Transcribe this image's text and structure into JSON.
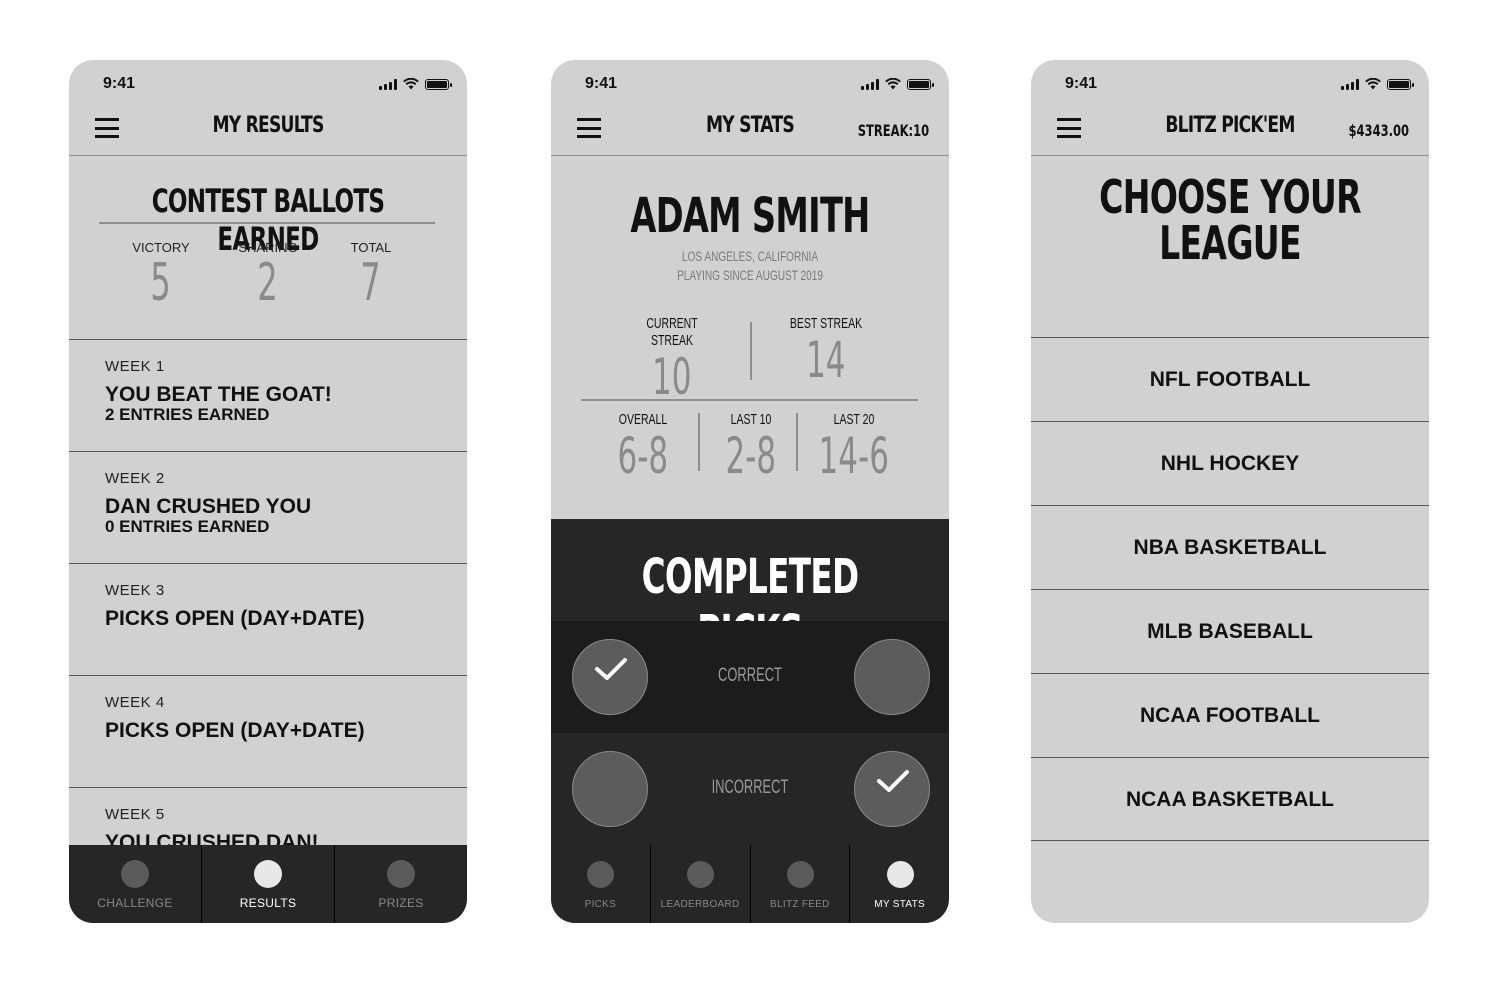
{
  "status_time": "9:41",
  "phone1": {
    "title": "MY RESULTS",
    "contest_title": "CONTEST BALLOTS EARNED",
    "stats": [
      {
        "label": "VICTORY",
        "value": "5"
      },
      {
        "label": "SHARING",
        "value": "2"
      },
      {
        "label": "TOTAL",
        "value": "7"
      }
    ],
    "weeks": [
      {
        "label": "WEEK 1",
        "headline": "YOU BEAT THE GOAT!",
        "sub": "2 ENTRIES EARNED"
      },
      {
        "label": "WEEK 2",
        "headline": "DAN CRUSHED YOU",
        "sub": "0 ENTRIES EARNED"
      },
      {
        "label": "WEEK 3",
        "headline": "PICKS OPEN (DAY+DATE)",
        "sub": ""
      },
      {
        "label": "WEEK 4",
        "headline": "PICKS OPEN (DAY+DATE)",
        "sub": ""
      },
      {
        "label": "WEEK 5",
        "headline": "YOU CRUSHED DAN!",
        "sub": ""
      }
    ],
    "tabs": [
      {
        "label": "CHALLENGE",
        "active": false
      },
      {
        "label": "RESULTS",
        "active": true
      },
      {
        "label": "PRIZES",
        "active": false
      }
    ]
  },
  "phone2": {
    "title": "MY STATS",
    "streak_badge": "STREAK:10",
    "name": "ADAM SMITH",
    "location": "LOS ANGELES, CALIFORNIA",
    "since": "PLAYING SINCE AUGUST 2019",
    "current_streak_label": "CURRENT STREAK",
    "current_streak": "10",
    "best_streak_label": "BEST STREAK",
    "best_streak": "14",
    "overall_label": "OVERALL",
    "overall": "6-8",
    "last10_label": "LAST 10",
    "last10": "2-8",
    "last20_label": "LAST 20",
    "last20": "14-6",
    "completed_title": "COMPLETED PICKS",
    "correct_label": "CORRECT",
    "incorrect_label": "INCORRECT",
    "tabs": [
      {
        "label": "PICKS",
        "active": false
      },
      {
        "label": "LEADERBOARD",
        "active": false
      },
      {
        "label": "BLITZ FEED",
        "active": false
      },
      {
        "label": "MY STATS",
        "active": true
      }
    ]
  },
  "phone3": {
    "title": "BLITZ PICK'EM",
    "balance": "$4343.00",
    "heading_line1": "CHOOSE YOUR",
    "heading_line2": "LEAGUE",
    "leagues": [
      "NFL FOOTBALL",
      "NHL HOCKEY",
      "NBA BASKETBALL",
      "MLB BASEBALL",
      "NCAA FOOTBALL",
      "NCAA BASKETBALL"
    ]
  }
}
